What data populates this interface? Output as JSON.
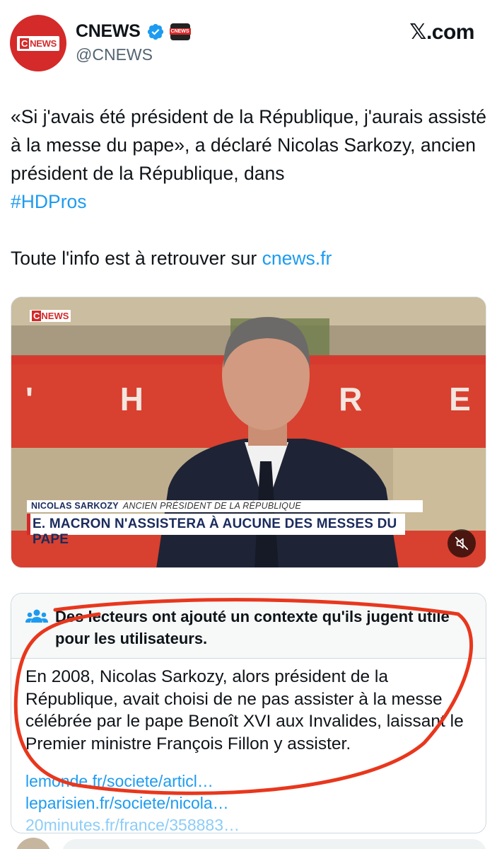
{
  "header": {
    "display_name": "CNEWS",
    "handle": "@CNEWS",
    "site": "𝕏.com",
    "avatar_logo_c": "C",
    "avatar_logo_text": "NEWS",
    "affiliate_badge_text": "CNEWS"
  },
  "tweet": {
    "text_part1": "«Si j'avais été président de la République, j'aurais assisté à la messe du pape», a déclaré Nicolas Sarkozy, ancien président de la République, dans",
    "hashtag": "#HDPros",
    "line2_prefix": "Toute l'info est à retrouver sur ",
    "line2_link": "cnews.fr"
  },
  "media": {
    "channel_logo_c": "C",
    "channel_logo_text": "NEWS",
    "lower_third_name": "NICOLAS SARKOZY",
    "lower_third_role": "ANCIEN PRÉSIDENT DE LA RÉPUBLIQUE",
    "lower_third_headline": "E. MACRON N'ASSISTERA À AUCUNE DES MESSES DU PAPE",
    "background_letters": "' H E R E",
    "mute_icon": "speaker-muted-icon"
  },
  "community_note": {
    "title": "Des lecteurs ont ajouté un contexte qu'ils jugent utile pour les utilisateurs.",
    "body": "En 2008, Nicolas Sarkozy, alors président de la République, avait choisi de ne pas assister à la messe célébrée par le pape Benoît XVI aux Invalides, laissant le Premier ministre François Fillon y assister.",
    "links": [
      "lemonde.fr/societe/articl…",
      "leparisien.fr/societe/nicola…",
      "20minutes.fr/france/358883…"
    ]
  },
  "colors": {
    "brand_red": "#d42a2a",
    "link_blue": "#1d9bf0",
    "verified_blue": "#1d9bf0",
    "annotation_red": "#e8371d",
    "muted_text": "#536471"
  }
}
